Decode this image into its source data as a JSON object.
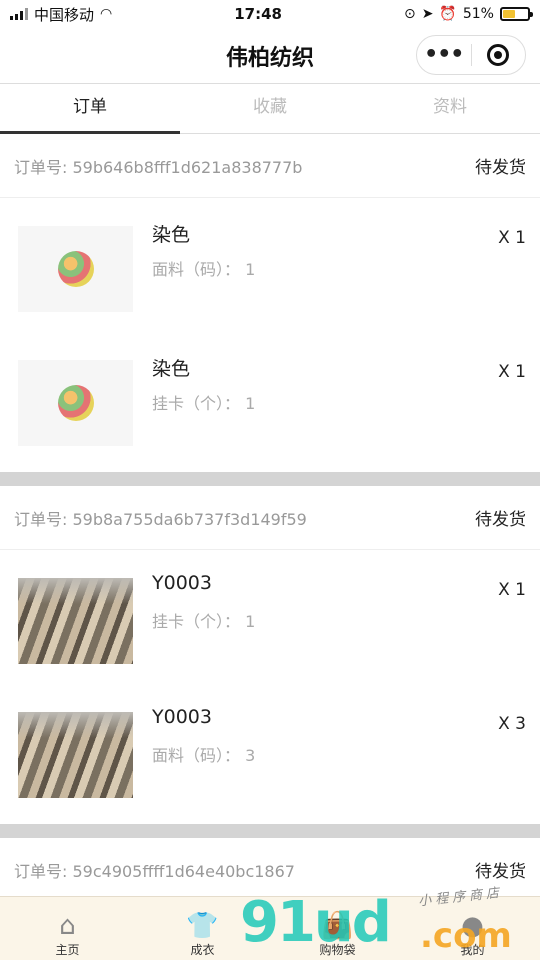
{
  "status_bar": {
    "carrier": "中国移动",
    "time": "17:48",
    "battery": "51%"
  },
  "header": {
    "title": "伟柏纺织"
  },
  "tabs": [
    {
      "label": "订单"
    },
    {
      "label": "收藏"
    },
    {
      "label": "资料"
    }
  ],
  "orders": [
    {
      "order_label": "订单号: 59b646b8fff1d621a838777b",
      "status": "待发货",
      "items": [
        {
          "name": "染色",
          "spec": "面料（码）： 1",
          "qty": "X 1"
        },
        {
          "name": "染色",
          "spec": "挂卡（个）： 1",
          "qty": "X 1"
        }
      ]
    },
    {
      "order_label": "订单号: 59b8a755da6b737f3d149f59",
      "status": "待发货",
      "items": [
        {
          "name": "Y0003",
          "spec": "挂卡（个）： 1",
          "qty": "X 1"
        },
        {
          "name": "Y0003",
          "spec": "面料（码）： 3",
          "qty": "X 3"
        }
      ]
    },
    {
      "order_label": "订单号: 59c4905ffff1d64e40bc1867",
      "status": "待发货"
    }
  ],
  "bottom_nav": [
    {
      "label": "主页",
      "icon": "home-icon"
    },
    {
      "label": "成衣",
      "icon": "shirt-icon"
    },
    {
      "label": "购物袋",
      "icon": "bag-icon"
    },
    {
      "label": "我的",
      "icon": "user-icon"
    }
  ],
  "watermark": {
    "brand": "91ud",
    "suffix": ".com",
    "caption": "小程序商店"
  }
}
